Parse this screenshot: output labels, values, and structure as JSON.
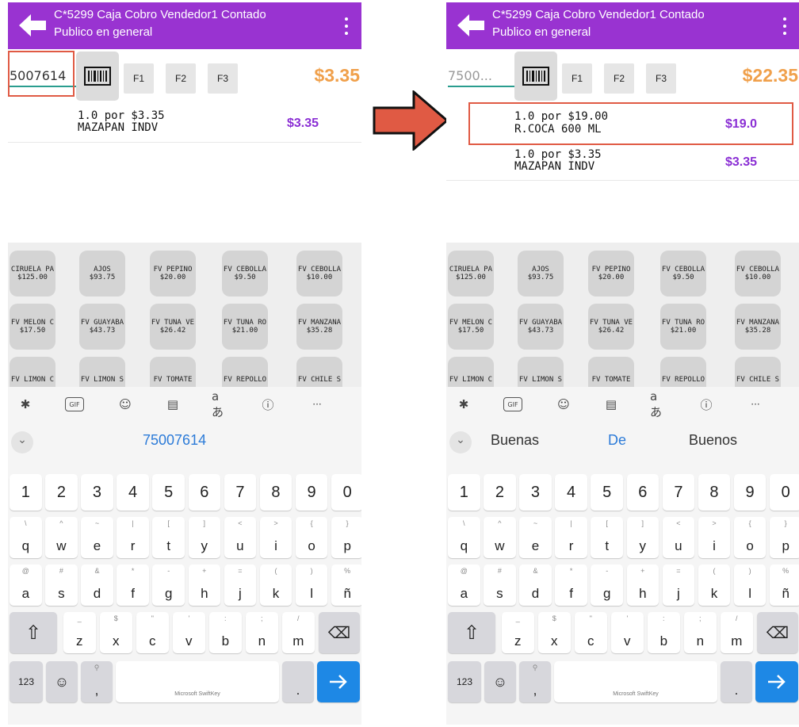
{
  "app": {
    "title_line1": "C*5299 Caja Cobro Vendedor1 Contado",
    "title_line2": "Publico en general"
  },
  "toolbar": {
    "f1_label": "F1",
    "f2_label": "F2",
    "f3_label": "F3"
  },
  "left": {
    "code_value": "5007614",
    "total": "$3.35",
    "items": [
      {
        "qty_line": "1.0 por $3.35",
        "name": "MAZAPAN INDV",
        "price": "$3.35"
      }
    ],
    "suggestion": "75007614"
  },
  "right": {
    "code_placeholder": "7500...",
    "total": "$22.35",
    "items": [
      {
        "qty_line": "1.0 por $19.00",
        "name": "R.COCA 600 ML",
        "price": "$19.0"
      },
      {
        "qty_line": "1.0 por $3.35",
        "name": "MAZAPAN INDV",
        "price": "$3.35"
      }
    ],
    "suggestions": [
      "Buenas",
      "De",
      "Buenos"
    ]
  },
  "products": [
    {
      "name": "CIRUELA PA",
      "price": "$125.00"
    },
    {
      "name": "AJOS",
      "price": "$93.75"
    },
    {
      "name": "FV PEPINO",
      "price": "$20.00"
    },
    {
      "name": "FV CEBOLLA",
      "price": "$9.50"
    },
    {
      "name": "FV CEBOLLA",
      "price": "$10.00"
    },
    {
      "name": "FV MELON C",
      "price": "$17.50"
    },
    {
      "name": "FV GUAYABA",
      "price": "$43.73"
    },
    {
      "name": "FV TUNA VE",
      "price": "$26.42"
    },
    {
      "name": "FV TUNA RO",
      "price": "$21.00"
    },
    {
      "name": "FV MANZANA",
      "price": "$35.28"
    },
    {
      "name": "FV LIMON C",
      "price": ""
    },
    {
      "name": "FV LIMON S",
      "price": ""
    },
    {
      "name": "FV TOMATE",
      "price": ""
    },
    {
      "name": "FV REPOLLO",
      "price": ""
    },
    {
      "name": "FV CHILE S",
      "price": ""
    }
  ],
  "keyboard": {
    "toolbar_icons": [
      "copilot-icon",
      "gif-icon",
      "sticker-icon",
      "clipboard-icon",
      "translate-icon",
      "info-icon",
      "more-icon"
    ],
    "translate_label": "aあ",
    "gif_label": "GIF",
    "more_label": "···",
    "number_row": [
      "1",
      "2",
      "3",
      "4",
      "5",
      "6",
      "7",
      "8",
      "9",
      "0"
    ],
    "row1": [
      [
        "q",
        "\\"
      ],
      [
        "w",
        "^"
      ],
      [
        "e",
        "~"
      ],
      [
        "r",
        "|"
      ],
      [
        "t",
        "["
      ],
      [
        "y",
        "]"
      ],
      [
        "u",
        "<"
      ],
      [
        "i",
        ">"
      ],
      [
        "o",
        "{"
      ],
      [
        "p",
        "}"
      ]
    ],
    "row2": [
      [
        "a",
        "@"
      ],
      [
        "s",
        "#"
      ],
      [
        "d",
        "&"
      ],
      [
        "f",
        "*"
      ],
      [
        "g",
        "-"
      ],
      [
        "h",
        "+"
      ],
      [
        "j",
        "="
      ],
      [
        "k",
        "("
      ],
      [
        "l",
        ")"
      ],
      [
        "ñ",
        "%"
      ]
    ],
    "row3": [
      [
        "z",
        "_"
      ],
      [
        "x",
        "$"
      ],
      [
        "c",
        "\""
      ],
      [
        "v",
        "'"
      ],
      [
        "b",
        ":"
      ],
      [
        "n",
        ";"
      ],
      [
        "m",
        "/"
      ]
    ],
    "mode_label": "123",
    "comma_label": ",",
    "period_label": ".",
    "space_label": "Microsoft SwiftKey",
    "colors": {
      "background": "#f5f5f5",
      "key": "#ffffff",
      "dark_key": "#d7d7dc",
      "enter": "#1e88e5"
    }
  },
  "colors": {
    "titlebar": "#9933d1",
    "total": "#f0a04b",
    "item_price": "#8a2ed4",
    "highlight": "#e05a44",
    "arrow": "#e05a44"
  }
}
